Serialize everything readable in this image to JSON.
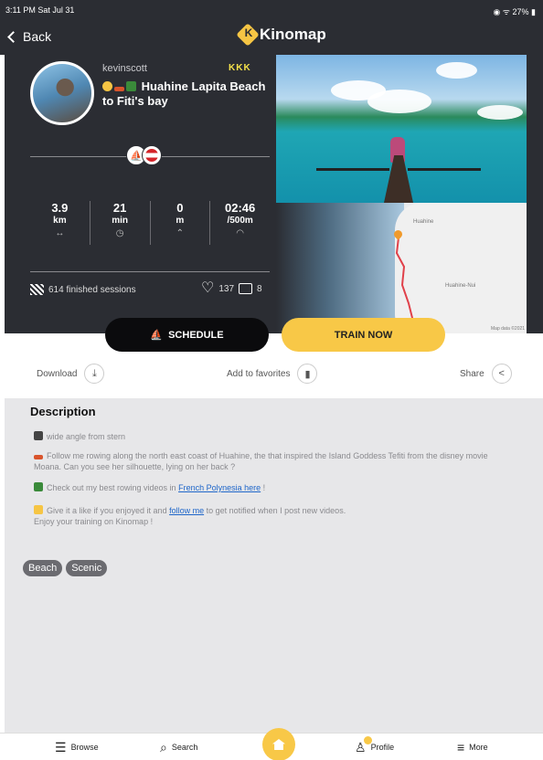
{
  "status": {
    "time": "3:11 PM  Sat Jul 31",
    "battery": "27%"
  },
  "nav": {
    "back": "Back",
    "brand": "Kinomap"
  },
  "video": {
    "username": "kevinscott",
    "rank": "KKK",
    "title": "Huahine Lapita Beach to Fiti's bay",
    "sport": "rowing",
    "country": "French Polynesia"
  },
  "stats": [
    {
      "value": "3.9",
      "unit": "km",
      "icon": "↔"
    },
    {
      "value": "21",
      "unit": "min",
      "icon": "◷"
    },
    {
      "value": "0",
      "unit": "m",
      "icon": "⌃"
    },
    {
      "value": "02:46",
      "unit": "/500m",
      "icon": "◠"
    }
  ],
  "footer": {
    "sessions": "614 finished sessions",
    "likes": "137",
    "comments": "8"
  },
  "map": {
    "label1": "Huahine",
    "label2": "Huahine-Nui",
    "copyright": "Map data ©2021"
  },
  "buttons": {
    "schedule": "SCHEDULE",
    "train": "TRAIN NOW"
  },
  "actions": {
    "download": "Download",
    "favorites": "Add to favorites",
    "share": "Share"
  },
  "description": {
    "heading": "Description",
    "line1": "wide angle from stern",
    "line2": "Follow me rowing along the north east coast of Huahine, the that inspired the Island Goddess Tefiti from the disney movie Moana. Can you see her silhouette, lying on her back ?",
    "line3_pre": "Check out my best rowing videos in ",
    "line3_link": "French Polynesia here",
    "line3_post": " !",
    "line4_pre": "Give it a like if you enjoyed it  and ",
    "line4_link": "follow me",
    "line4_post": " to get notified when I post new videos.",
    "line5": "Enjoy your training on Kinomap !"
  },
  "tags": [
    "Beach",
    "Scenic"
  ],
  "tabs": {
    "browse": "Browse",
    "search": "Search",
    "profile": "Profile",
    "more": "More"
  },
  "colors": {
    "accent": "#f8c847",
    "dark": "#2b2d33",
    "link": "#1f66c9"
  }
}
